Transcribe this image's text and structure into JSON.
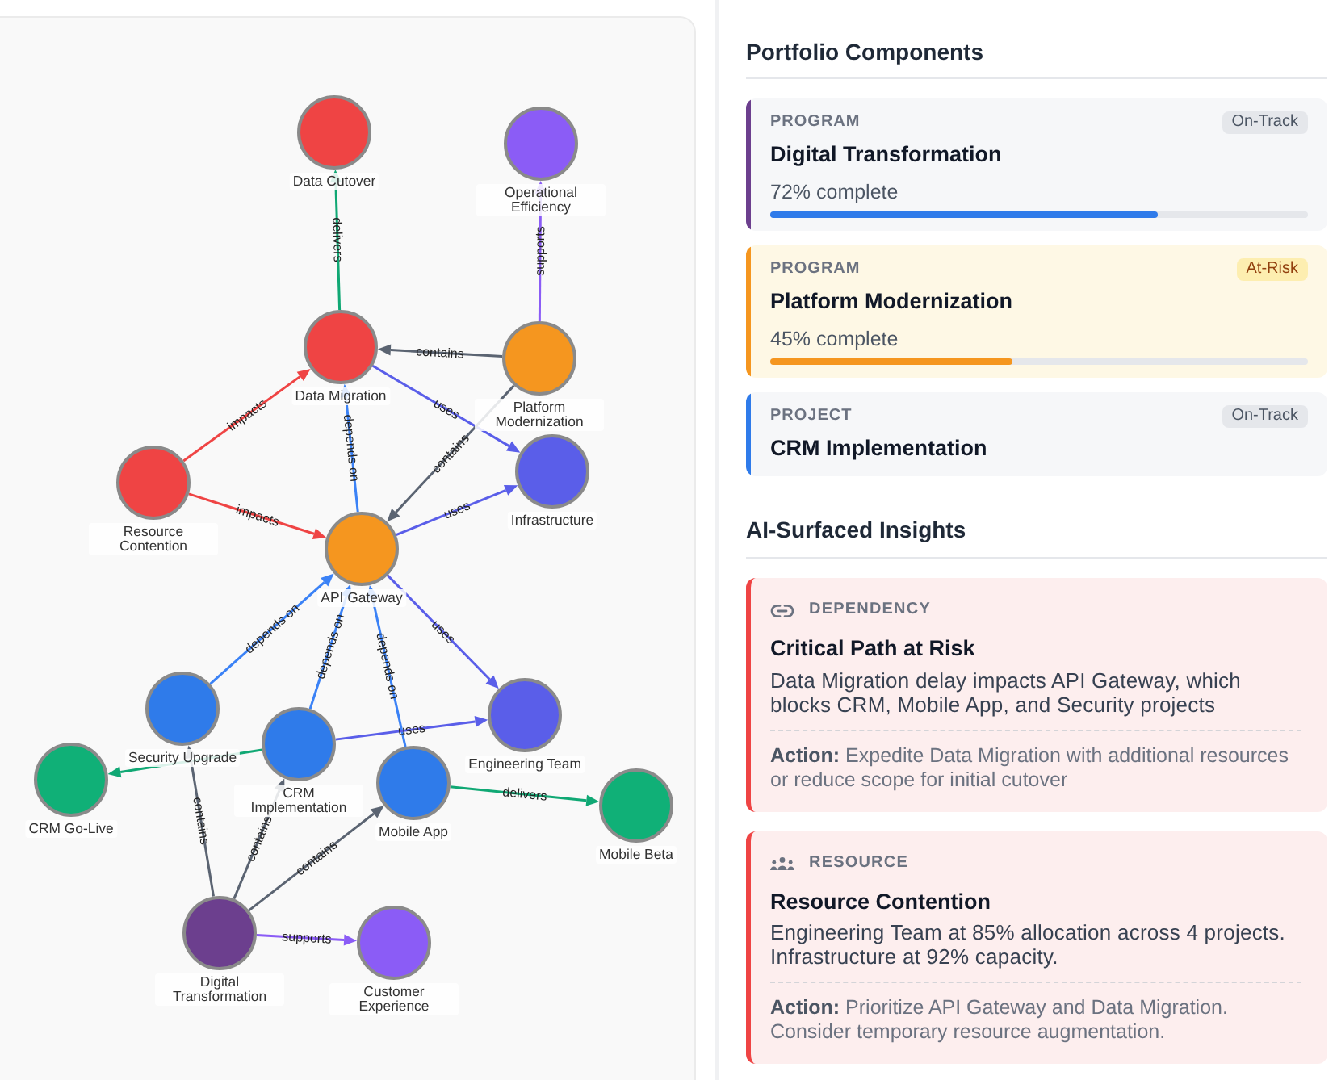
{
  "graph": {
    "nodes": [
      {
        "label": "Data Cutover",
        "color": "#ef4444"
      },
      {
        "label": "Operational Efficiency",
        "color": "#8b5cf6"
      },
      {
        "label": "Data Migration",
        "color": "#ef4444"
      },
      {
        "label": "Platform Modernization",
        "color": "#f5961f"
      },
      {
        "label": "Resource Contention",
        "color": "#ef4444"
      },
      {
        "label": "Infrastructure",
        "color": "#5a5ee9"
      },
      {
        "label": "API Gateway",
        "color": "#f5961f"
      },
      {
        "label": "Security Upgrade",
        "color": "#2f7bea"
      },
      {
        "label": "CRM Implementation",
        "color": "#2f7bea"
      },
      {
        "label": "Engineering Team",
        "color": "#5a5ee9"
      },
      {
        "label": "CRM Go-Live",
        "color": "#10b077"
      },
      {
        "label": "Mobile App",
        "color": "#2f7bea"
      },
      {
        "label": "Mobile Beta",
        "color": "#10b077"
      },
      {
        "label": "Digital Transformation",
        "color": "#6c3f8e"
      },
      {
        "label": "Customer Experience",
        "color": "#8b5cf6"
      }
    ],
    "edges": [
      {
        "label": "delivers",
        "color": "#10a874"
      },
      {
        "label": "supports",
        "color": "#8b5cf6"
      },
      {
        "label": "contains",
        "color": "#5b6472"
      },
      {
        "label": "uses",
        "color": "#5a5ee9"
      },
      {
        "label": "impacts",
        "color": "#ef4444"
      },
      {
        "label": "depends on",
        "color": "#3b82f6"
      },
      {
        "label": "contains",
        "color": "#5b6472"
      },
      {
        "label": "impacts",
        "color": "#ef4444"
      },
      {
        "label": "uses",
        "color": "#5a5ee9"
      },
      {
        "label": "depends on",
        "color": "#3b82f6"
      },
      {
        "label": "depends on",
        "color": "#3b82f6"
      },
      {
        "label": "depends on",
        "color": "#3b82f6"
      },
      {
        "label": "uses",
        "color": "#5a5ee9"
      },
      {
        "label": "uses",
        "color": "#5a5ee9"
      },
      {
        "color": "#10a874"
      },
      {
        "label": "delivers",
        "color": "#10a874"
      },
      {
        "label": "contains",
        "color": "#5b6472"
      },
      {
        "label": "contains",
        "color": "#5b6472"
      },
      {
        "label": "contains",
        "color": "#5b6472"
      },
      {
        "label": "supports",
        "color": "#8b5cf6"
      }
    ]
  },
  "portfolio": {
    "title": "Portfolio Components",
    "items": [
      {
        "type": "PROGRAM",
        "name": "Digital Transformation",
        "status": "On-Track",
        "at_risk": false,
        "progress_text": "72% complete",
        "level": 0.72,
        "color": "#6c3f8e"
      },
      {
        "type": "PROGRAM",
        "name": "Platform Modernization",
        "status": "At-Risk",
        "at_risk": true,
        "progress_text": "45% complete",
        "level": 0.45,
        "color": "#f5961f"
      },
      {
        "type": "PROJECT",
        "name": "CRM Implementation",
        "status": "On-Track",
        "at_risk": false,
        "color": "#2f7bea"
      }
    ]
  },
  "insights": {
    "title": "AI-Surfaced Insights",
    "items": [
      {
        "kind": "dependency",
        "category": "DEPENDENCY",
        "title": "Critical Path at Risk",
        "description": "Data Migration delay impacts API Gateway, which blocks CRM, Mobile App, and Security projects",
        "action": "**Action:** Expedite Data Migration with additional resources or reduce scope for initial cutover"
      },
      {
        "kind": "resource",
        "category": "RESOURCE",
        "title": "Resource Contention",
        "description": "Engineering Team at 85% allocation across 4 projects. Infrastructure at 92% capacity.",
        "action": "**Action:** Prioritize API Gateway and Data Migration. Consider temporary resource augmentation."
      }
    ]
  }
}
